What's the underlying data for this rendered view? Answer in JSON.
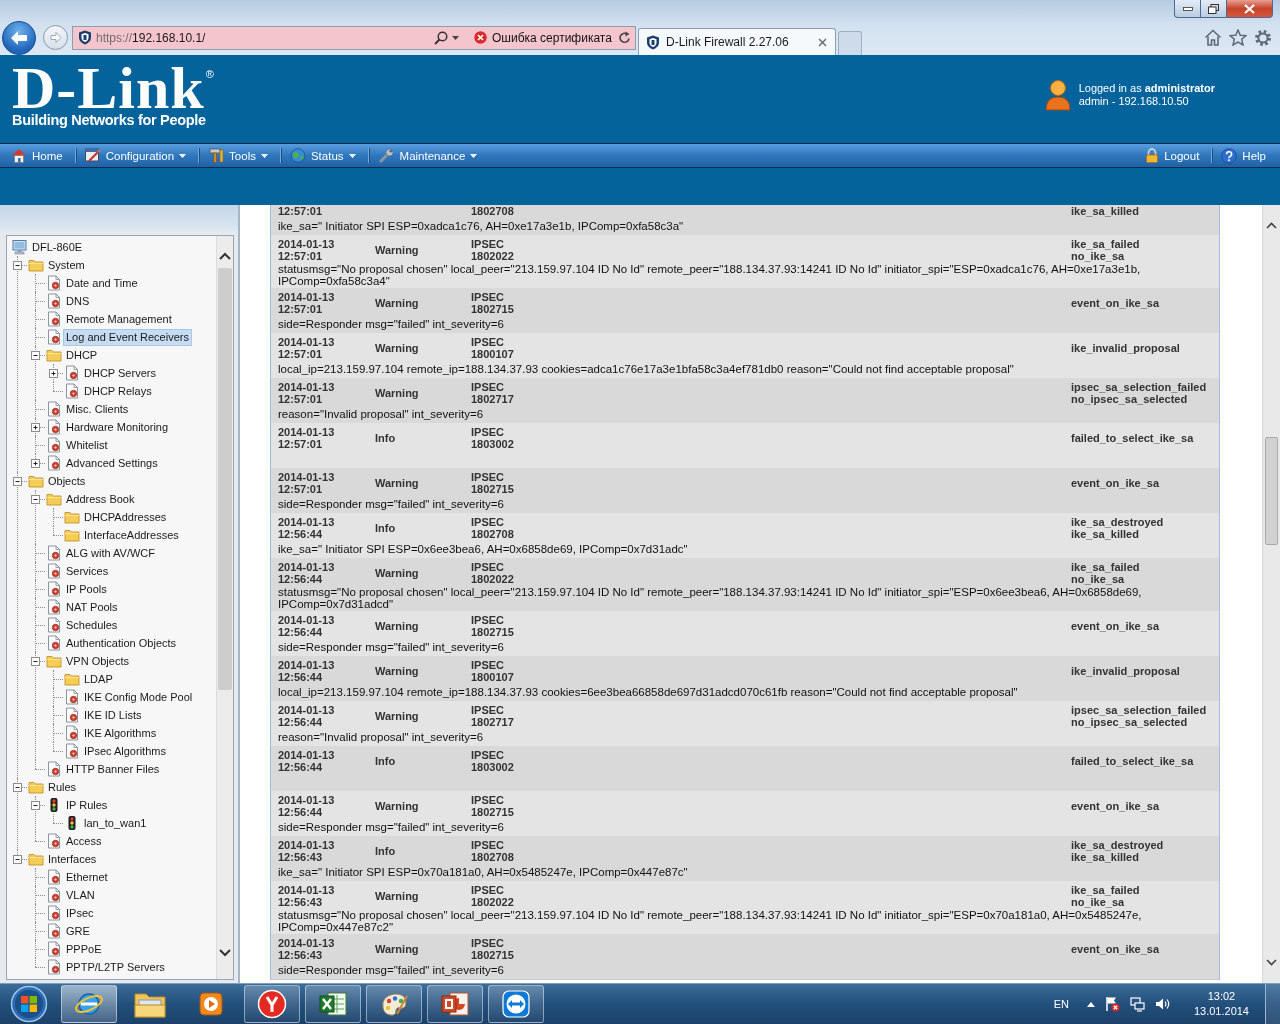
{
  "browser": {
    "address": {
      "scheme": "https://",
      "host": "192.168.10.1/",
      "certificate_error": "Ошибка сертификата"
    },
    "tabs": [
      {
        "title": "D-Link Firewall 2.27.06",
        "selected": true
      }
    ]
  },
  "header": {
    "logo": "D-Link",
    "logo_mark": "®",
    "tagline": "Building Networks for People",
    "login": "Logged in as **administrator**",
    "login_detail": "admin - 192.168.10.50"
  },
  "menu": [
    {
      "kind": "home",
      "label": "Home",
      "dropdown": false
    },
    {
      "kind": "configuration",
      "label": "Configuration",
      "dropdown": true
    },
    {
      "kind": "tools",
      "label": "Tools",
      "dropdown": true
    },
    {
      "kind": "status",
      "label": "Status",
      "dropdown": true
    },
    {
      "kind": "maintenance",
      "label": "Maintenance",
      "dropdown": true
    }
  ],
  "menu_right": [
    {
      "kind": "logout",
      "label": "Logout"
    },
    {
      "kind": "help",
      "label": "Help"
    }
  ],
  "tree": [
    {
      "label": "DFL-860E",
      "kind": "device",
      "selected": false,
      "children": [
        {
          "label": "System",
          "kind": "folder",
          "selected": false,
          "expanded": true,
          "children": [
            {
              "label": "Date and Time",
              "kind": "item",
              "selected": false
            },
            {
              "label": "DNS",
              "kind": "item",
              "selected": false
            },
            {
              "label": "Remote Management",
              "kind": "item",
              "selected": false
            },
            {
              "label": "Log and Event Receivers",
              "kind": "item",
              "selected": true
            },
            {
              "label": "DHCP",
              "kind": "folder",
              "selected": false,
              "expanded": true,
              "children": [
                {
                  "label": "DHCP Servers",
                  "kind": "item",
                  "selected": false,
                  "expanded": false
                },
                {
                  "label": "DHCP Relays",
                  "kind": "item",
                  "selected": false
                }
              ]
            },
            {
              "label": "Misc. Clients",
              "kind": "item",
              "selected": false
            },
            {
              "label": "Hardware Monitoring",
              "kind": "item",
              "selected": false,
              "expanded": false
            },
            {
              "label": "Whitelist",
              "kind": "item",
              "selected": false
            },
            {
              "label": "Advanced Settings",
              "kind": "item",
              "selected": false,
              "expanded": false
            }
          ]
        },
        {
          "label": "Objects",
          "kind": "folder",
          "selected": false,
          "expanded": true,
          "children": [
            {
              "label": "Address Book",
              "kind": "folder",
              "selected": false,
              "expanded": true,
              "children": [
                {
                  "label": "DHCPAddresses",
                  "kind": "folder",
                  "selected": false
                },
                {
                  "label": "InterfaceAddresses",
                  "kind": "folder",
                  "selected": false
                }
              ]
            },
            {
              "label": "ALG with AV/WCF",
              "kind": "item",
              "selected": false
            },
            {
              "label": "Services",
              "kind": "item",
              "selected": false
            },
            {
              "label": "IP Pools",
              "kind": "item",
              "selected": false
            },
            {
              "label": "NAT Pools",
              "kind": "item",
              "selected": false
            },
            {
              "label": "Schedules",
              "kind": "item",
              "selected": false
            },
            {
              "label": "Authentication Objects",
              "kind": "item",
              "selected": false
            },
            {
              "label": "VPN Objects",
              "kind": "folder",
              "selected": false,
              "expanded": true,
              "children": [
                {
                  "label": "LDAP",
                  "kind": "folder",
                  "selected": false
                },
                {
                  "label": "IKE Config Mode Pool",
                  "kind": "item",
                  "selected": false
                },
                {
                  "label": "IKE ID Lists",
                  "kind": "item",
                  "selected": false
                },
                {
                  "label": "IKE Algorithms",
                  "kind": "item",
                  "selected": false
                },
                {
                  "label": "IPsec Algorithms",
                  "kind": "item",
                  "selected": false
                }
              ]
            },
            {
              "label": "HTTP Banner Files",
              "kind": "item",
              "selected": false
            }
          ]
        },
        {
          "label": "Rules",
          "kind": "folder",
          "selected": false,
          "expanded": true,
          "children": [
            {
              "label": "IP Rules",
              "kind": "rule",
              "selected": false,
              "expanded": true,
              "children": [
                {
                  "label": "lan_to_wan1",
                  "kind": "rule",
                  "selected": false
                }
              ]
            },
            {
              "label": "Access",
              "kind": "item",
              "selected": false
            }
          ]
        },
        {
          "label": "Interfaces",
          "kind": "folder",
          "selected": false,
          "expanded": true,
          "children": [
            {
              "label": "Ethernet",
              "kind": "item",
              "selected": false
            },
            {
              "label": "VLAN",
              "kind": "item",
              "selected": false
            },
            {
              "label": "IPsec",
              "kind": "item",
              "selected": false
            },
            {
              "label": "GRE",
              "kind": "item",
              "selected": false
            },
            {
              "label": "PPPoE",
              "kind": "item",
              "selected": false
            },
            {
              "label": "PPTP/L2TP Servers",
              "kind": "item",
              "selected": false
            }
          ]
        }
      ]
    }
  ],
  "log": {
    "entries": [
      {
        "time": "12:57:01",
        "id": "1802708",
        "events": [
          "ike_sa_killed"
        ],
        "message": "ike_sa=\" Initiator SPI ESP=0xadca1c76, AH=0xe17a3e1b, IPComp=0xfa58c3a\""
      },
      {
        "date": "2014-01-13",
        "time": "12:57:01",
        "severity": "Warning",
        "category": "IPSEC",
        "id": "1802022",
        "events": [
          "ike_sa_failed",
          "no_ike_sa"
        ],
        "message": "statusmsg=\"No proposal chosen\" local_peer=\"213.159.97.104 ID No Id\" remote_peer=\"188.134.37.93:14241 ID No Id\" initiator_spi=\"ESP=0xadca1c76, AH=0xe17a3e1b, IPComp=0xfa58c3a4\""
      },
      {
        "date": "2014-01-13",
        "time": "12:57:01",
        "severity": "Warning",
        "category": "IPSEC",
        "id": "1802715",
        "events": [
          "event_on_ike_sa"
        ],
        "message": "side=Responder msg=\"failed\" int_severity=6"
      },
      {
        "date": "2014-01-13",
        "time": "12:57:01",
        "severity": "Warning",
        "category": "IPSEC",
        "id": "1800107",
        "events": [
          "ike_invalid_proposal"
        ],
        "message": "local_ip=213.159.97.104 remote_ip=188.134.37.93 cookies=adca1c76e17a3e1bfa58c3a4ef781db0 reason=\"Could not find acceptable proposal\""
      },
      {
        "date": "2014-01-13",
        "time": "12:57:01",
        "severity": "Warning",
        "category": "IPSEC",
        "id": "1802717",
        "events": [
          "ipsec_sa_selection_failed",
          "no_ipsec_sa_selected"
        ],
        "message": "reason=\"Invalid proposal\" int_severity=6"
      },
      {
        "date": "2014-01-13",
        "time": "12:57:01",
        "severity": "Info",
        "category": "IPSEC",
        "id": "1803002",
        "events": [
          "failed_to_select_ike_sa"
        ]
      },
      {
        "date": "2014-01-13",
        "time": "12:57:01",
        "severity": "Warning",
        "category": "IPSEC",
        "id": "1802715",
        "events": [
          "event_on_ike_sa"
        ],
        "message": "side=Responder msg=\"failed\" int_severity=6"
      },
      {
        "date": "2014-01-13",
        "time": "12:56:44",
        "severity": "Info",
        "category": "IPSEC",
        "id": "1802708",
        "events": [
          "ike_sa_destroyed",
          "ike_sa_killed"
        ],
        "message": "ike_sa=\" Initiator SPI ESP=0x6ee3bea6, AH=0x6858de69, IPComp=0x7d31adc\""
      },
      {
        "date": "2014-01-13",
        "time": "12:56:44",
        "severity": "Warning",
        "category": "IPSEC",
        "id": "1802022",
        "events": [
          "ike_sa_failed",
          "no_ike_sa"
        ],
        "message": "statusmsg=\"No proposal chosen\" local_peer=\"213.159.97.104 ID No Id\" remote_peer=\"188.134.37.93:14241 ID No Id\" initiator_spi=\"ESP=0x6ee3bea6, AH=0x6858de69, IPComp=0x7d31adcd\""
      },
      {
        "date": "2014-01-13",
        "time": "12:56:44",
        "severity": "Warning",
        "category": "IPSEC",
        "id": "1802715",
        "events": [
          "event_on_ike_sa"
        ],
        "message": "side=Responder msg=\"failed\" int_severity=6"
      },
      {
        "date": "2014-01-13",
        "time": "12:56:44",
        "severity": "Warning",
        "category": "IPSEC",
        "id": "1800107",
        "events": [
          "ike_invalid_proposal"
        ],
        "message": "local_ip=213.159.97.104 remote_ip=188.134.37.93 cookies=6ee3bea66858de697d31adcd070c61fb reason=\"Could not find acceptable proposal\""
      },
      {
        "date": "2014-01-13",
        "time": "12:56:44",
        "severity": "Warning",
        "category": "IPSEC",
        "id": "1802717",
        "events": [
          "ipsec_sa_selection_failed",
          "no_ipsec_sa_selected"
        ],
        "message": "reason=\"Invalid proposal\" int_severity=6"
      },
      {
        "date": "2014-01-13",
        "time": "12:56:44",
        "severity": "Info",
        "category": "IPSEC",
        "id": "1803002",
        "events": [
          "failed_to_select_ike_sa"
        ]
      },
      {
        "date": "2014-01-13",
        "time": "12:56:44",
        "severity": "Warning",
        "category": "IPSEC",
        "id": "1802715",
        "events": [
          "event_on_ike_sa"
        ],
        "message": "side=Responder msg=\"failed\" int_severity=6"
      },
      {
        "date": "2014-01-13",
        "time": "12:56:43",
        "severity": "Info",
        "category": "IPSEC",
        "id": "1802708",
        "events": [
          "ike_sa_destroyed",
          "ike_sa_killed"
        ],
        "message": "ike_sa=\" Initiator SPI ESP=0x70a181a0, AH=0x5485247e, IPComp=0x447e87c\""
      },
      {
        "date": "2014-01-13",
        "time": "12:56:43",
        "severity": "Warning",
        "category": "IPSEC",
        "id": "1802022",
        "events": [
          "ike_sa_failed",
          "no_ike_sa"
        ],
        "message": "statusmsg=\"No proposal chosen\" local_peer=\"213.159.97.104 ID No Id\" remote_peer=\"188.134.37.93:14241 ID No Id\" initiator_spi=\"ESP=0x70a181a0, AH=0x5485247e, IPComp=0x447e87c2\""
      },
      {
        "date": "2014-01-13",
        "time": "12:56:43",
        "severity": "Warning",
        "category": "IPSEC",
        "id": "1802715",
        "events": [
          "event_on_ike_sa"
        ],
        "message": "side=Responder msg=\"failed\" int_severity=6"
      }
    ]
  },
  "taskbar": {
    "apps": [
      {
        "kind": "browser",
        "running": true,
        "selected": true
      },
      {
        "kind": "files",
        "running": false,
        "selected": false
      },
      {
        "kind": "player",
        "running": false,
        "selected": false
      },
      {
        "kind": "yandex",
        "running": true,
        "selected": false
      },
      {
        "kind": "spreadsheet",
        "running": true,
        "selected": false
      },
      {
        "kind": "paint",
        "running": true,
        "selected": false
      },
      {
        "kind": "slides",
        "running": true,
        "selected": false
      },
      {
        "kind": "remote",
        "running": true,
        "selected": false
      }
    ],
    "language": "EN",
    "time": "13:02",
    "date": "13.01.2014"
  }
}
